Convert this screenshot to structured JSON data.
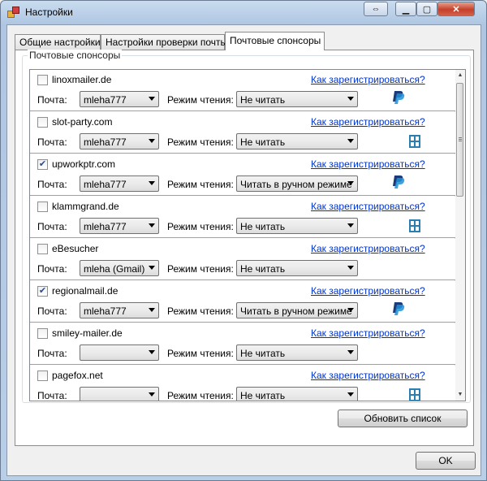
{
  "window": {
    "title": "Настройки"
  },
  "tabs": [
    {
      "label": "Общие настройки"
    },
    {
      "label": "Настройки проверки почты"
    },
    {
      "label": "Почтовые спонсоры"
    }
  ],
  "group": {
    "title": "Почтовые спонсоры"
  },
  "labels": {
    "mail": "Почта:",
    "mode": "Режим чтения:",
    "register_link": "Как зарегистрироваться?"
  },
  "sponsors": [
    {
      "name": "linoxmailer.de",
      "checked": false,
      "mail": "mleha777",
      "mode": "Не читать",
      "icon": "paypal-icon"
    },
    {
      "name": "slot-party.com",
      "checked": false,
      "mail": "mleha777",
      "mode": "Не читать",
      "icon": "lose-icon"
    },
    {
      "name": "upworkptr.com",
      "checked": true,
      "mail": "mleha777",
      "mode": "Читать в ручном режиме",
      "icon": "paypal-icon"
    },
    {
      "name": "klammgrand.de",
      "checked": false,
      "mail": "mleha777",
      "mode": "Не читать",
      "icon": "lose-icon"
    },
    {
      "name": "eBesucher",
      "checked": false,
      "mail": "mleha (Gmail)",
      "mode": "Не читать",
      "icon": ""
    },
    {
      "name": "regionalmail.de",
      "checked": true,
      "mail": "mleha777",
      "mode": "Читать в ручном режиме",
      "icon": "paypal-icon"
    },
    {
      "name": "smiley-mailer.de",
      "checked": false,
      "mail": "",
      "mode": "Не читать",
      "icon": ""
    },
    {
      "name": "pagefox.net",
      "checked": false,
      "mail": "",
      "mode": "Не читать",
      "icon": "lose-icon"
    }
  ],
  "buttons": {
    "refresh": "Обновить список",
    "ok": "OK"
  },
  "colors": {
    "link": "#0033cc",
    "paypal_dark": "#1b3a7a",
    "paypal_light": "#1e90d6",
    "lose": "#2b7fb0"
  }
}
